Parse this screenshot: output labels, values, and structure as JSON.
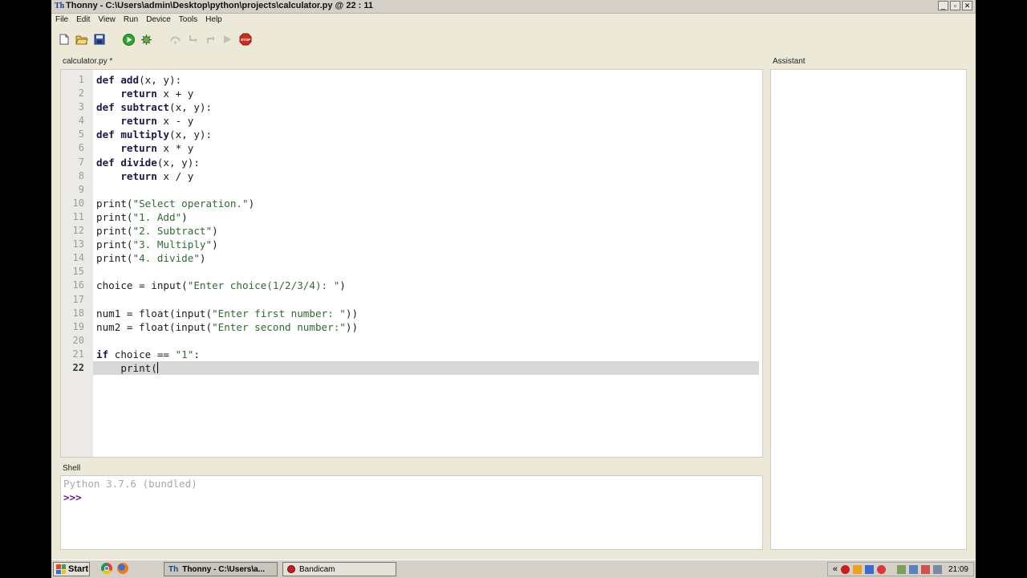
{
  "window": {
    "title": "Thonny - C:\\Users\\admin\\Desktop\\python\\projects\\calculator.py @ 22 : 11",
    "app_icon": "Th"
  },
  "menu": [
    "File",
    "Edit",
    "View",
    "Run",
    "Device",
    "Tools",
    "Help"
  ],
  "toolbar": {
    "icons": [
      "new-file-icon",
      "open-file-icon",
      "save-icon",
      "run-icon",
      "debug-icon",
      "step-over-icon",
      "step-into-icon",
      "step-out-icon",
      "resume-icon",
      "stop-icon"
    ],
    "stop_label": "STOP"
  },
  "editor": {
    "tab_label": "calculator.py *",
    "current_line": 22,
    "lines": [
      {
        "n": "1"
      },
      {
        "n": "2"
      },
      {
        "n": "3"
      },
      {
        "n": "4"
      },
      {
        "n": "5"
      },
      {
        "n": "6"
      },
      {
        "n": "7"
      },
      {
        "n": "8"
      },
      {
        "n": "9"
      },
      {
        "n": "10"
      },
      {
        "n": "11"
      },
      {
        "n": "12"
      },
      {
        "n": "13"
      },
      {
        "n": "14"
      },
      {
        "n": "15"
      },
      {
        "n": "16"
      },
      {
        "n": "17"
      },
      {
        "n": "18"
      },
      {
        "n": "19"
      },
      {
        "n": "20"
      },
      {
        "n": "21"
      },
      {
        "n": "22"
      }
    ],
    "code": {
      "l1_kw": "def",
      "l1_name": " add",
      "l1_rest": "(x, y):",
      "l2_indent": "    ",
      "l2_kw": "return",
      "l2_rest": " x + y",
      "l3_kw": "def",
      "l3_name": " subtract",
      "l3_rest": "(x, y):",
      "l4_indent": "    ",
      "l4_kw": "return",
      "l4_rest": " x - y",
      "l5_kw": "def",
      "l5_name": " multiply",
      "l5_rest": "(x, y):",
      "l6_indent": "    ",
      "l6_kw": "return",
      "l6_rest": " x * y",
      "l7_kw": "def",
      "l7_name": " divide",
      "l7_rest": "(x, y):",
      "l8_indent": "    ",
      "l8_kw": "return",
      "l8_rest": " x / y",
      "l10_a": "print(",
      "l10_s": "\"Select operation.\"",
      "l10_b": ")",
      "l11_a": "print(",
      "l11_s": "\"1. Add\"",
      "l11_b": ")",
      "l12_a": "print(",
      "l12_s": "\"2. Subtract\"",
      "l12_b": ")",
      "l13_a": "print(",
      "l13_s": "\"3. Multiply\"",
      "l13_b": ")",
      "l14_a": "print(",
      "l14_s": "\"4. divide\"",
      "l14_b": ")",
      "l16_a": "choice = input(",
      "l16_s": "\"Enter choice(1/2/3/4): \"",
      "l16_b": ")",
      "l18_a": "num1 = float(input(",
      "l18_s": "\"Enter first number: \"",
      "l18_b": "))",
      "l19_a": "num2 = float(input(",
      "l19_s": "\"Enter second number:\"",
      "l19_b": "))",
      "l21_kw": "if",
      "l21_a": " choice == ",
      "l21_s": "\"1\"",
      "l21_b": ":",
      "l22_a": "    print("
    }
  },
  "shell": {
    "label": "Shell",
    "banner": "Python 3.7.6 (bundled)",
    "prompt": ">>>"
  },
  "assistant": {
    "label": "Assistant"
  },
  "taskbar": {
    "start_label": "Start",
    "quick_launch": [
      "chrome-icon",
      "firefox-icon"
    ],
    "tasks": [
      {
        "label": "Thonny - C:\\Users\\a...",
        "icon": "thonny-icon",
        "active": true
      },
      {
        "label": "Bandicam",
        "icon": "bandicam-icon",
        "active": false
      }
    ],
    "tray_chevron": "«",
    "clock": "21:09"
  },
  "colors": {
    "screen_bg": "#ece9d8",
    "current_line_highlight": "#d8d8d8",
    "string": "#2f6b2f",
    "keyword": "#1a1a4a",
    "prompt": "#6a1a8a",
    "run_green": "#2fa32f",
    "stop_red": "#d42a1e"
  }
}
